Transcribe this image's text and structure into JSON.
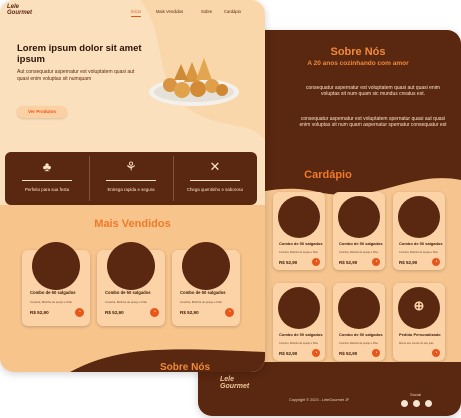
{
  "colors": {
    "brown": "#5a2710",
    "orange": "#e8561a",
    "peach": "#fbd3a6",
    "cream": "#fbe0bd"
  },
  "brand": {
    "logo_line1": "Lele",
    "logo_line2": "Gourmet"
  },
  "nav": {
    "items": [
      "Início",
      "Mais Vendidos",
      "Sobre",
      "Cardápio"
    ],
    "active_index": 0
  },
  "hero": {
    "title": "Lorem ipsum dolor sit amet ipsum",
    "text": "Aut consequatur aspernatur est voluptatem quasi aut quasi enim voluptas sit numquam",
    "button": "Ver Produtos"
  },
  "features": [
    {
      "icon": "cake-icon",
      "text": "Perfeito para sua festa"
    },
    {
      "icon": "moped-icon",
      "text": "Entrega rapida e segura"
    },
    {
      "icon": "cutlery-icon",
      "text": "Chega quentinho e saboroso"
    }
  ],
  "mais_vendidos": {
    "title": "Mais Vendidos",
    "items": [
      {
        "name": "Combo de 50 salgados",
        "desc": "Coxinha, Bolinha de queijo e Kibe",
        "price": "R$ 52,90"
      },
      {
        "name": "Combo de 50 salgados",
        "desc": "Coxinha, Bolinha de queijo e Kibe",
        "price": "R$ 52,90"
      },
      {
        "name": "Combo de 50 salgados",
        "desc": "Coxinha, Bolinha de queijo e Kibe",
        "price": "R$ 52,90"
      }
    ]
  },
  "sobre": {
    "title": "Sobre Nós",
    "subtitle": "A 20 anos cozinhando com amor",
    "p1": "consequatur aspernatur est voluptatem quasi aut quasi enim voluptas sit num quam sic mundus creatus est.",
    "p2": "consequatur aspernatur est voluptatem spernatur quasi aut quasi enim voluptas sit num quam aspernatur spernatur consequatur est"
  },
  "sobre_footer_title": "Sobre Nós",
  "cardapio": {
    "title": "Cardápio",
    "items": [
      {
        "name": "Combo de 50 salgados",
        "desc": "Coxinha, Bolinha de queijo e Kibe",
        "price": "R$ 52,90"
      },
      {
        "name": "Combo de 50 salgados",
        "desc": "Coxinha, Bolinha de queijo e Kibe",
        "price": "R$ 52,90"
      },
      {
        "name": "Combo de 50 salgados",
        "desc": "Coxinha, Bolinha de queijo e Kibe",
        "price": "R$ 52,90"
      },
      {
        "name": "Combo de 50 salgados",
        "desc": "Coxinha, Bolinha de queijo e Kibe",
        "price": "R$ 52,90"
      },
      {
        "name": "Combo de 50 salgados",
        "desc": "Coxinha, Bolinha de queijo e Kibe",
        "price": "R$ 52,90"
      },
      {
        "name": "Pedido Personalizado",
        "desc": "Monte seu combo do seu jeito",
        "price": "R$ 52,90"
      }
    ]
  },
  "footer": {
    "copyright": "Copyright © 2023 - LeleGourmet JF",
    "social_label": "Social",
    "social_icons": [
      "instagram-icon",
      "facebook-icon",
      "whatsapp-icon"
    ]
  }
}
